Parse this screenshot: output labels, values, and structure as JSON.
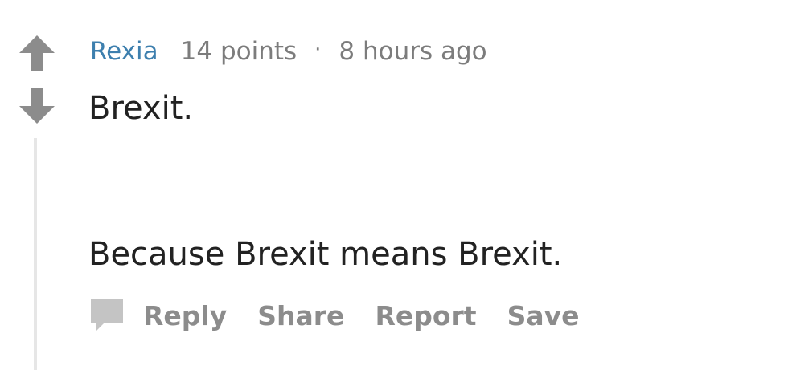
{
  "comment": {
    "author": "Rexia",
    "points": "14 points",
    "separator": "·",
    "timestamp": "8 hours ago",
    "body": [
      "Brexit.",
      "Because Brexit means Brexit."
    ],
    "actions": {
      "reply": "Reply",
      "share": "Share",
      "report": "Report",
      "save": "Save"
    }
  },
  "icons": {
    "upvote": "arrow-up-icon",
    "downvote": "arrow-down-icon",
    "comment": "comment-bubble-icon"
  },
  "colors": {
    "author": "#3d7fae",
    "meta": "#7c7c7c",
    "body_text": "#222222",
    "action_text": "#8c8c8c",
    "vote_arrow": "#8c8c8c",
    "thread_line": "#e6e6e6"
  }
}
